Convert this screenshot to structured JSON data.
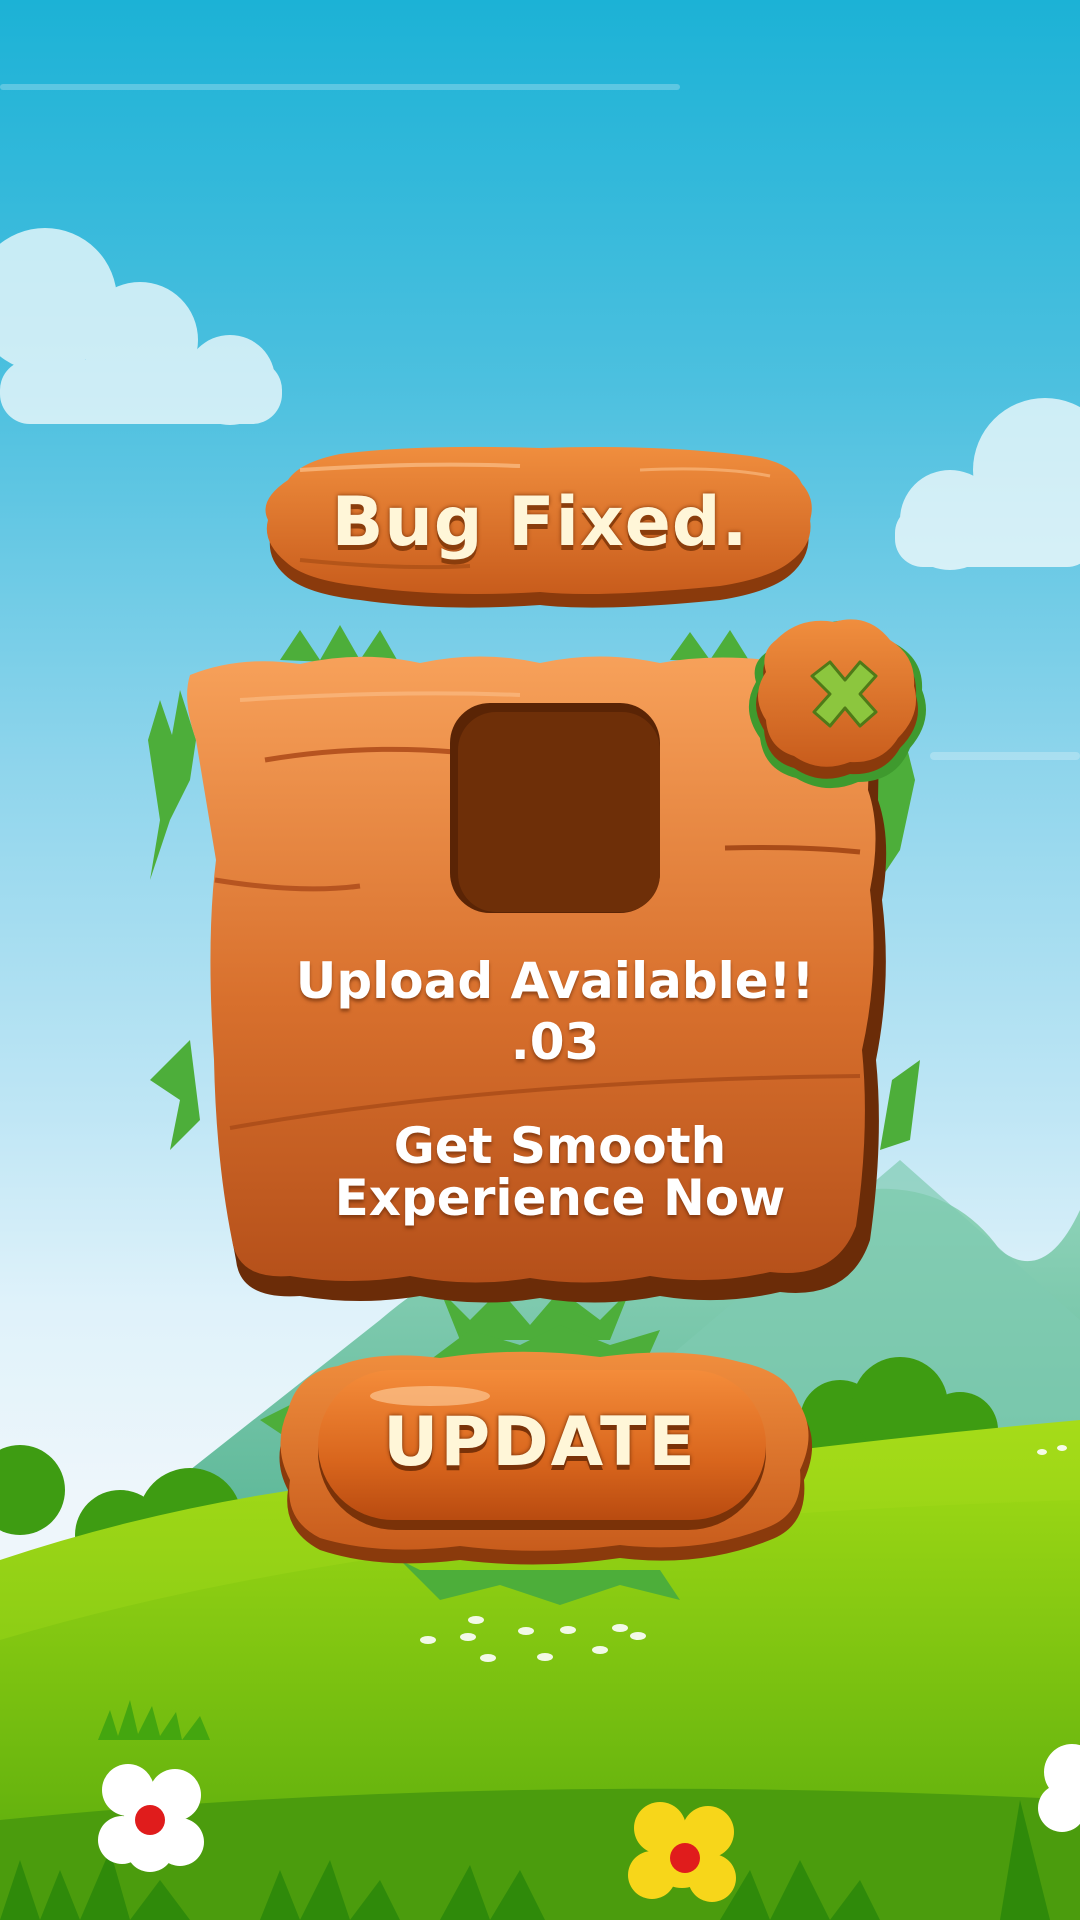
{
  "popup": {
    "title": "Bug Fixed.",
    "message_line1": "Upload Available!!",
    "message_line2": ".03",
    "message_line3": "Get Smooth",
    "message_line4": "Experience Now",
    "update_label": "UPDATE"
  },
  "icons": {
    "close": "close-x-icon",
    "placeholder": "app-icon-placeholder"
  },
  "colors": {
    "sky_top": "#1cb2d6",
    "wood": "#e0783a",
    "wood_dark": "#6b2c08",
    "grass": "#8fd414",
    "title_text": "#fff6d8",
    "close_x": "#8cc63e"
  }
}
